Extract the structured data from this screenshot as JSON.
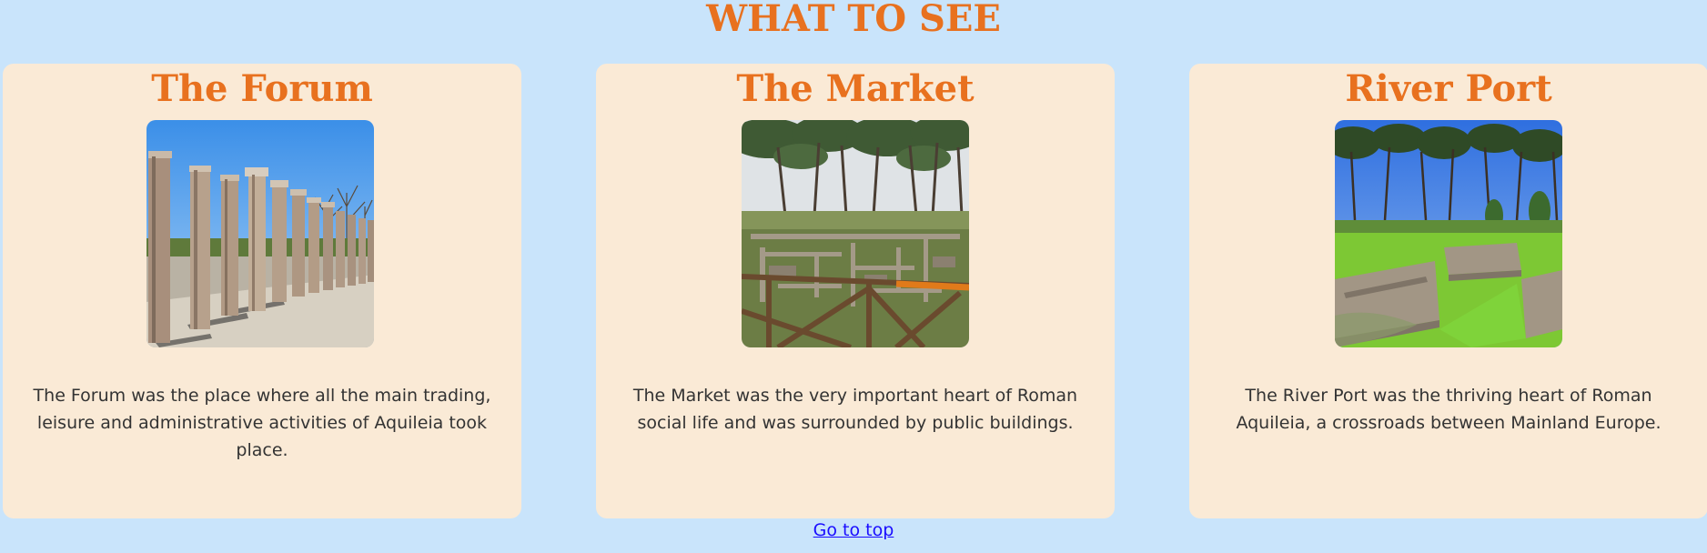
{
  "section": {
    "title": "WHAT TO SEE"
  },
  "cards": [
    {
      "title": "The Forum",
      "description": "The Forum was the place where all the main trading, leisure and administrative activities of Aquileia took place."
    },
    {
      "title": "The Market",
      "description": "The Market was the very important heart of Roman social life and was surrounded by public buildings."
    },
    {
      "title": "River Port",
      "description": "The River Port was the thriving heart of Roman Aquileia, a crossroads between Mainland Europe."
    }
  ],
  "footer": {
    "go_top_label": "Go to top"
  },
  "colors": {
    "page_background": "#c9e4fb",
    "card_background": "#faead6",
    "heading_accent": "#e8711f",
    "link": "#1a0dff"
  }
}
